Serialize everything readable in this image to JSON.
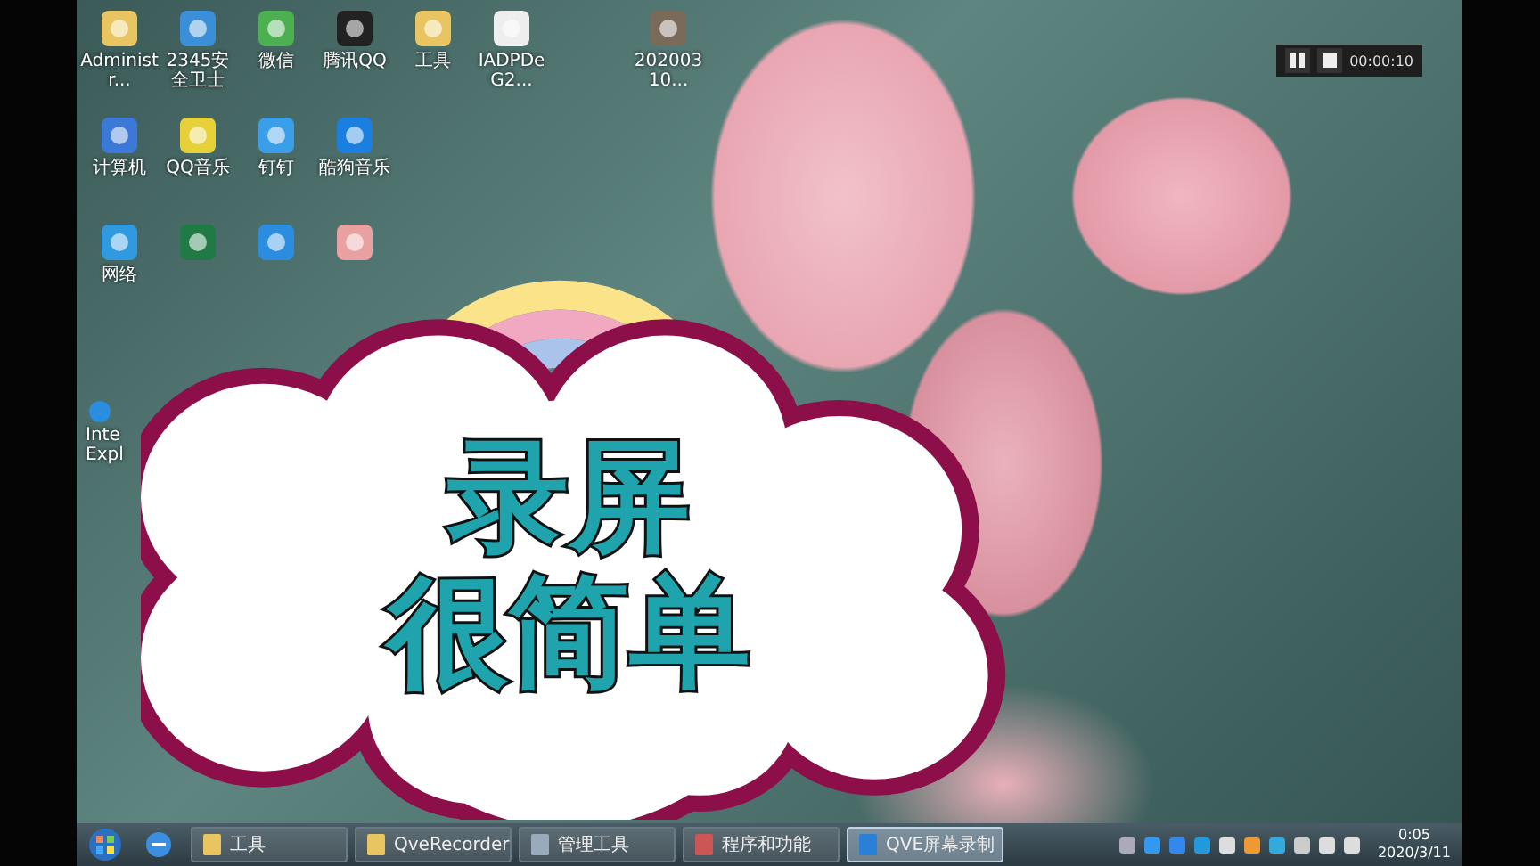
{
  "desktop": {
    "icon_rows": [
      [
        {
          "label": "Administr...",
          "kind": "folder"
        },
        {
          "label": "2345安全卫士",
          "kind": "shield"
        },
        {
          "label": "微信",
          "kind": "chat"
        },
        {
          "label": "腾讯QQ",
          "kind": "penguin"
        },
        {
          "label": "工具",
          "kind": "folder"
        },
        {
          "label": "IADPDeG2...",
          "kind": "document"
        },
        {
          "label": "20200310...",
          "kind": "video"
        }
      ],
      [
        {
          "label": "计算机",
          "kind": "computer"
        },
        {
          "label": "QQ音乐",
          "kind": "music"
        },
        {
          "label": "钉钉",
          "kind": "wing"
        },
        {
          "label": "酷狗音乐",
          "kind": "k"
        }
      ],
      [
        {
          "label": "网络",
          "kind": "globe"
        },
        {
          "kind": "sheet"
        },
        {
          "kind": "browser"
        },
        {
          "kind": "paint"
        }
      ]
    ],
    "lower_icons": [
      {
        "label": "Inte Expl",
        "kind": "browser"
      }
    ]
  },
  "recorder": {
    "time": "00:00:10"
  },
  "overlay": {
    "lines": [
      "录屏",
      "很简单"
    ]
  },
  "taskbar": {
    "tasks": [
      {
        "label": "工具",
        "kind": "folder",
        "selected": false
      },
      {
        "label": "QveRecorder",
        "kind": "folder",
        "selected": false
      },
      {
        "label": "管理工具",
        "kind": "tools",
        "selected": false
      },
      {
        "label": "程序和功能",
        "kind": "programs",
        "selected": false
      },
      {
        "label": "QVE屏幕录制",
        "kind": "recorder",
        "selected": true
      }
    ],
    "clock": {
      "time": "0:05",
      "date": "2020/3/11"
    }
  }
}
